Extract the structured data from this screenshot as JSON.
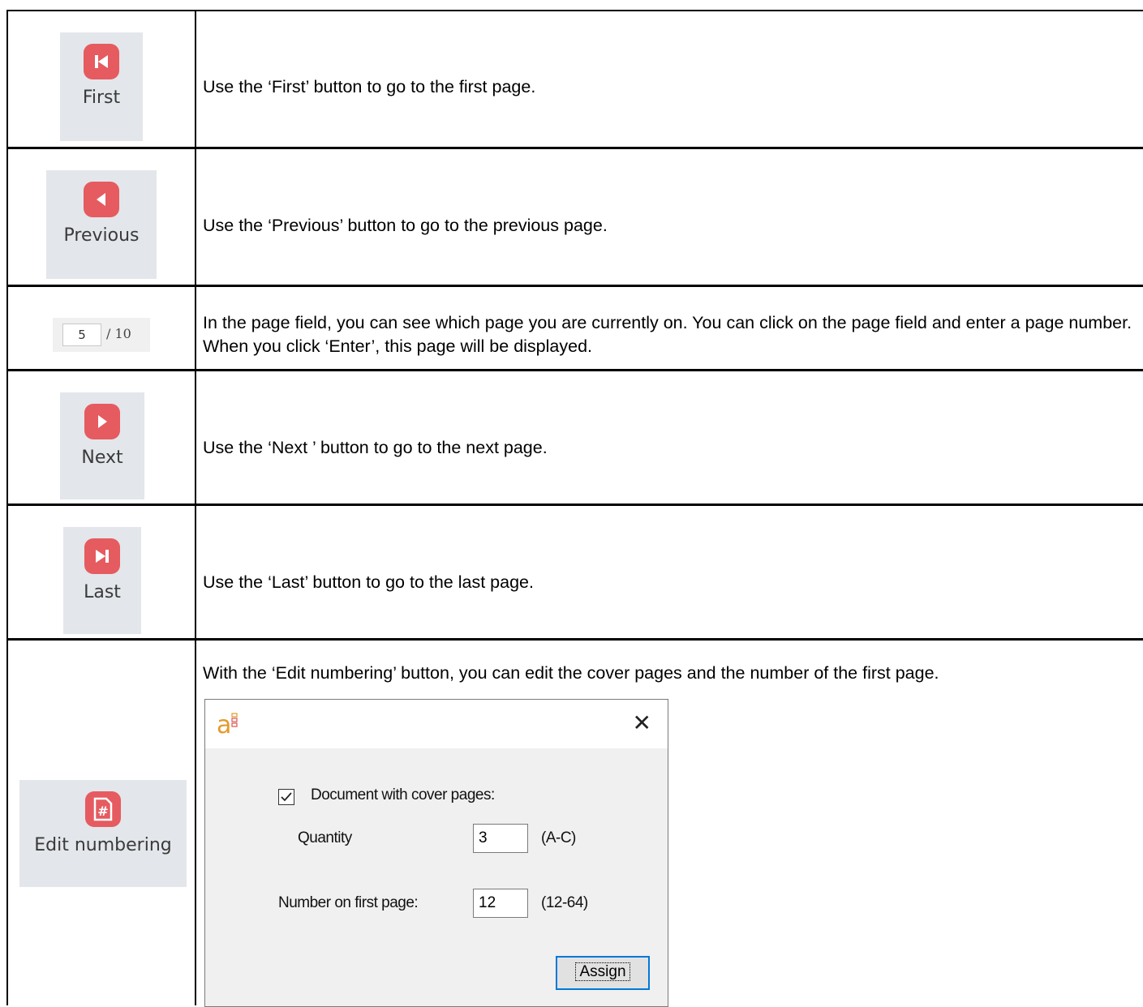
{
  "rows": [
    {
      "button_label": "First",
      "icon": "skip-first-icon",
      "description": "Use the ‘First’ button to go to the first page."
    },
    {
      "button_label": "Previous",
      "icon": "previous-icon",
      "description": "Use the ‘Previous’ button to go to the previous page."
    },
    {
      "page_field": {
        "current": "5",
        "total": "/ 10"
      },
      "description": "In the page field, you can see which page you are currently on. You can click on the page field and enter a page number. When you click ‘Enter’, this page will be displayed."
    },
    {
      "button_label": "Next",
      "icon": "next-icon",
      "description": "Use the ‘Next ’ button to go to the next page."
    },
    {
      "button_label": "Last",
      "icon": "skip-last-icon",
      "description": "Use the ‘Last’ button to go to the last page."
    },
    {
      "button_label": "Edit numbering",
      "icon": "edit-numbering-icon",
      "description": "With the ‘Edit numbering’ button, you can edit the cover pages and the number of the first page."
    }
  ],
  "dialog": {
    "logo": "a",
    "close": "✕",
    "cover_checkbox_label": "Document with cover pages:",
    "cover_checked": true,
    "quantity_label": "Quantity",
    "quantity_value": "3",
    "quantity_range": "(A-C)",
    "first_page_label": "Number on first page:",
    "first_page_value": "12",
    "first_page_range": "(12-64)",
    "assign_label": "Assign"
  },
  "colors": {
    "accent": "#e55b60",
    "button_bg": "#e3e6ea",
    "focus": "#0078d7"
  }
}
